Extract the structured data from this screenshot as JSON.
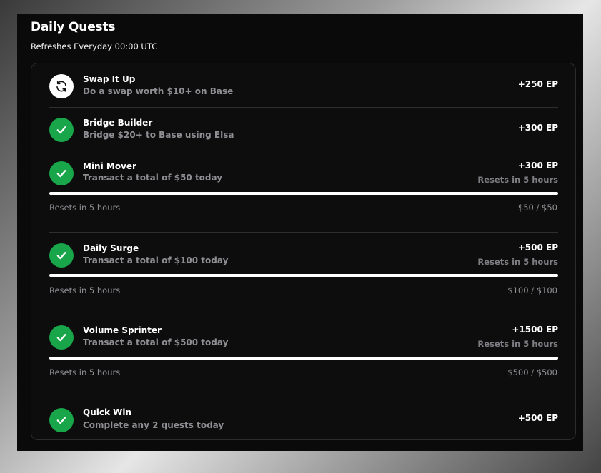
{
  "header": {
    "title": "Daily Quests",
    "subtitle": "Refreshes Everyday 00:00 UTC"
  },
  "colors": {
    "accent_green": "#19a64a",
    "background": "#0a0a0b",
    "progress_fill": "#ffffff"
  },
  "quests": [
    {
      "name": "Swap It Up",
      "description": "Do a swap worth $10+ on Base",
      "reward": "+250 EP",
      "icon": "swap-arrows-icon"
    },
    {
      "name": "Bridge Builder",
      "description": "Bridge $20+ to Base using Elsa",
      "reward": "+300 EP",
      "icon": "check-icon"
    },
    {
      "name": "Mini Mover",
      "description": "Transact a total of $50 today",
      "reward": "+300 EP",
      "reset": "Resets in 5 hours",
      "footer_reset": "Resets in 5 hours",
      "progress_text": "$50 / $50",
      "progress": 1.0,
      "icon": "check-icon"
    },
    {
      "name": "Daily Surge",
      "description": "Transact a total of $100 today",
      "reward": "+500 EP",
      "reset": "Resets in 5 hours",
      "footer_reset": "Resets in 5 hours",
      "progress_text": "$100 / $100",
      "progress": 1.0,
      "icon": "check-icon"
    },
    {
      "name": "Volume Sprinter",
      "description": "Transact a total of $500 today",
      "reward": "+1500 EP",
      "reset": "Resets in 5 hours",
      "footer_reset": "Resets in 5 hours",
      "progress_text": "$500 / $500",
      "progress": 1.0,
      "icon": "check-icon"
    },
    {
      "name": "Quick Win",
      "description": "Complete any 2 quests today",
      "reward": "+500 EP",
      "icon": "check-icon"
    }
  ]
}
